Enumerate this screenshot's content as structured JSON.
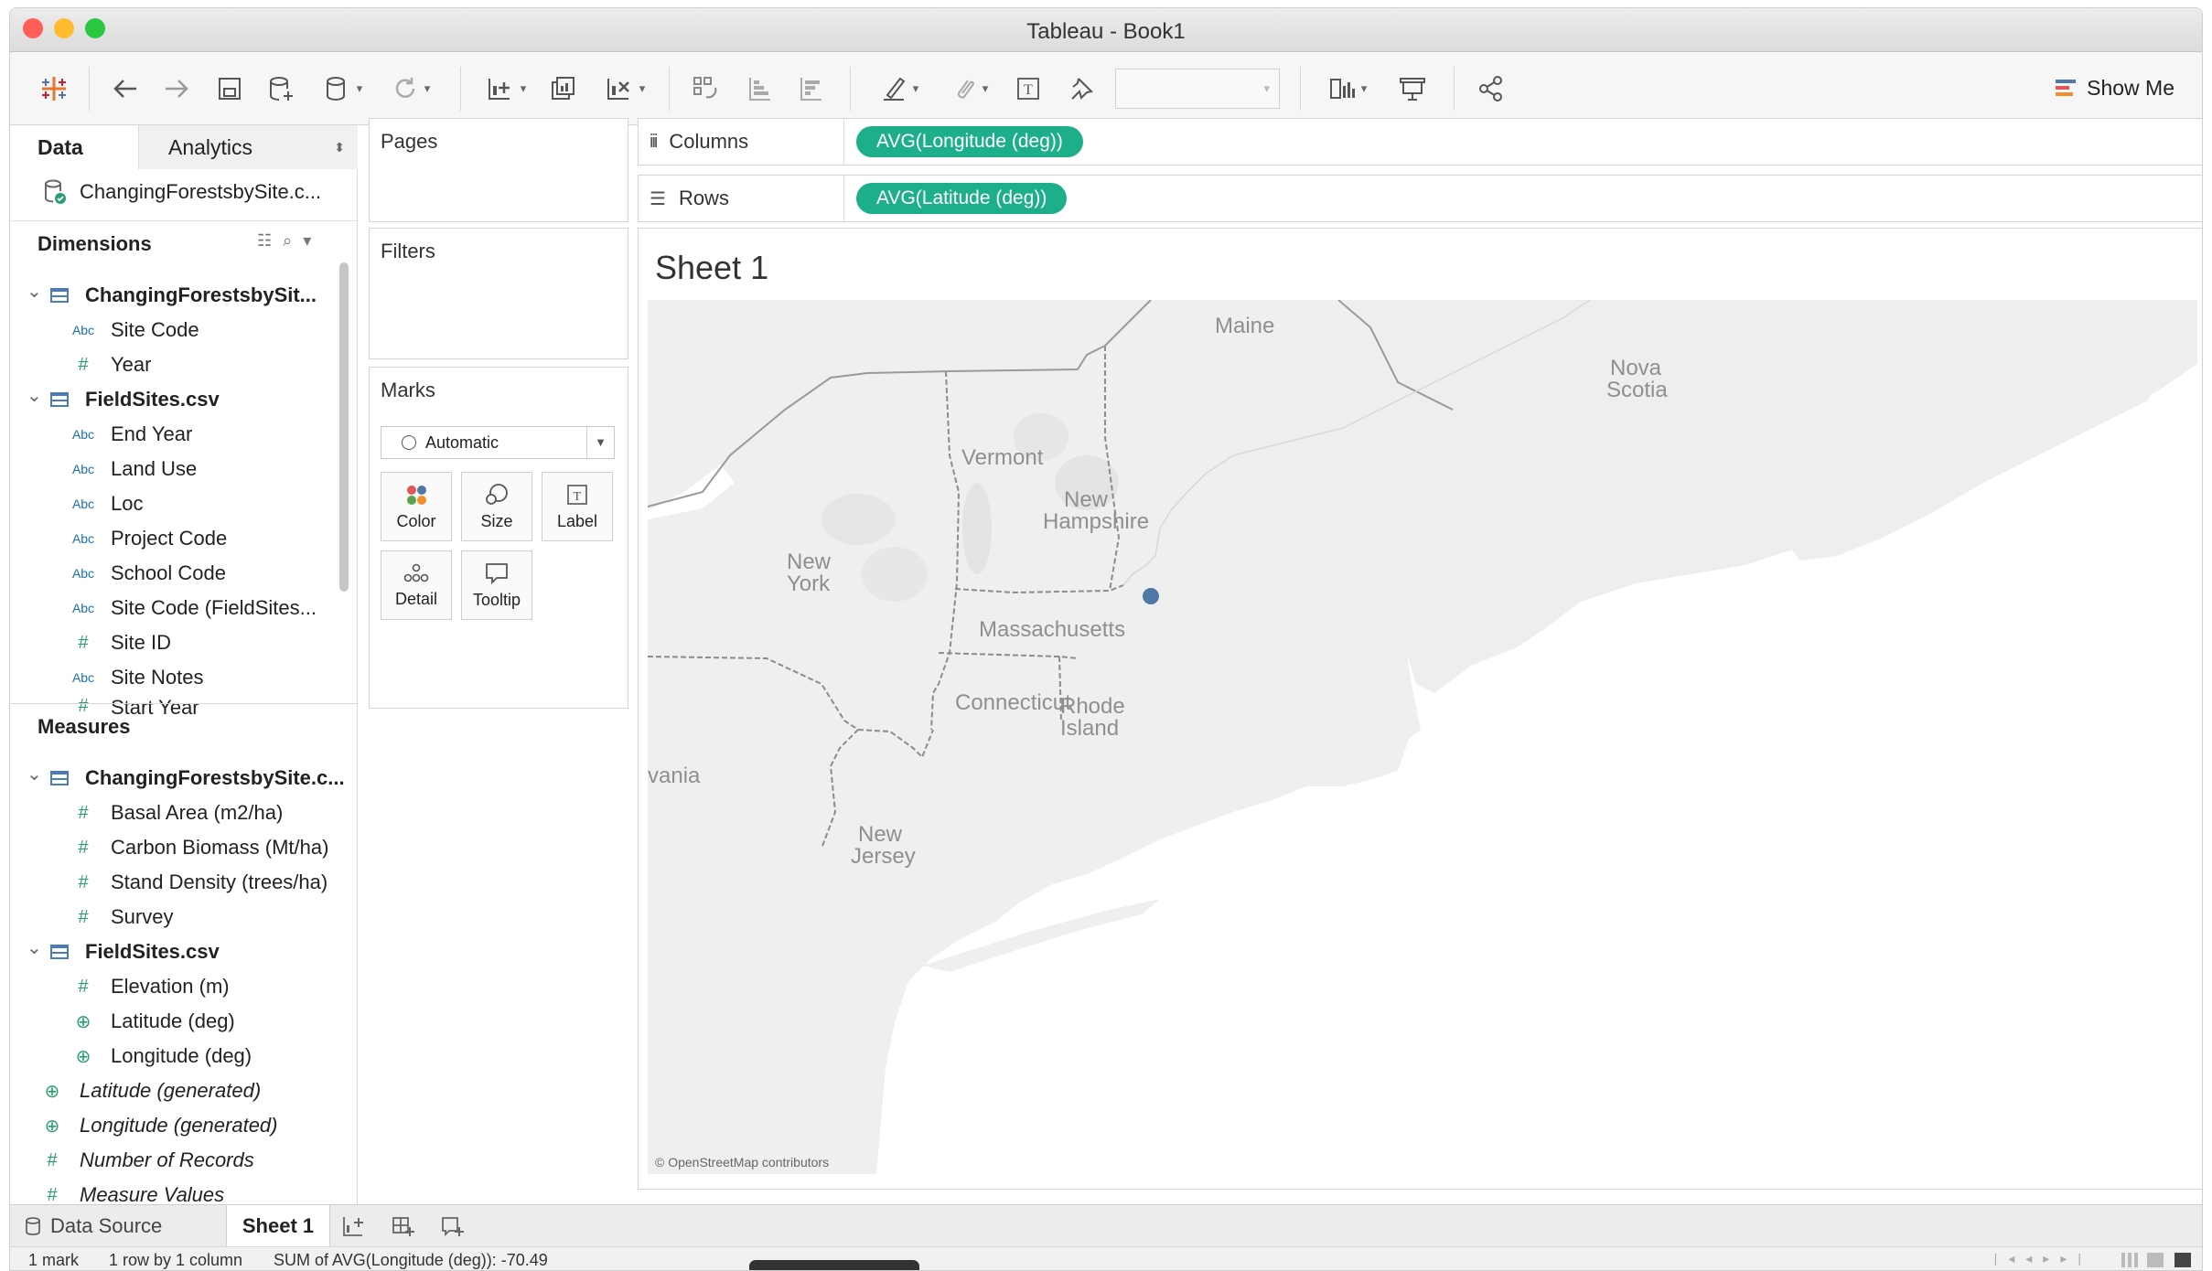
{
  "window": {
    "title": "Tableau - Book1"
  },
  "toolbar": {
    "show_me": "Show Me"
  },
  "left_pane": {
    "tabs": [
      "Data",
      "Analytics"
    ],
    "datasource": "ChangingForestsbySite.c...",
    "dimensions_label": "Dimensions",
    "measures_label": "Measures",
    "dimensions": [
      {
        "type": "table",
        "label": "ChangingForestsbySit..."
      },
      {
        "type": "abc",
        "label": "Site Code"
      },
      {
        "type": "num",
        "label": "Year"
      },
      {
        "type": "table",
        "label": "FieldSites.csv"
      },
      {
        "type": "abc",
        "label": "End Year"
      },
      {
        "type": "abc",
        "label": "Land Use"
      },
      {
        "type": "abc",
        "label": "Loc"
      },
      {
        "type": "abc",
        "label": "Project Code"
      },
      {
        "type": "abc",
        "label": "School Code"
      },
      {
        "type": "abc",
        "label": "Site Code (FieldSites..."
      },
      {
        "type": "num",
        "label": "Site ID"
      },
      {
        "type": "abc",
        "label": "Site Notes"
      },
      {
        "type": "num",
        "label": "Start Year"
      }
    ],
    "measures": [
      {
        "type": "table",
        "label": "ChangingForestsbySite.c..."
      },
      {
        "type": "num",
        "label": "Basal Area (m2/ha)"
      },
      {
        "type": "num",
        "label": "Carbon Biomass (Mt/ha)"
      },
      {
        "type": "num",
        "label": "Stand Density (trees/ha)"
      },
      {
        "type": "num",
        "label": "Survey"
      },
      {
        "type": "table",
        "label": "FieldSites.csv"
      },
      {
        "type": "num",
        "label": "Elevation (m)"
      },
      {
        "type": "geo",
        "label": "Latitude (deg)"
      },
      {
        "type": "geo",
        "label": "Longitude (deg)"
      },
      {
        "type": "geo",
        "label": "Latitude (generated)"
      },
      {
        "type": "geo",
        "label": "Longitude (generated)"
      },
      {
        "type": "num",
        "label": "Number of Records"
      },
      {
        "type": "num",
        "label": "Measure Values"
      }
    ]
  },
  "cards": {
    "pages": "Pages",
    "filters": "Filters",
    "marks": "Marks",
    "marks_type": "Automatic",
    "mark_buttons": [
      "Color",
      "Size",
      "Label",
      "Detail",
      "Tooltip"
    ]
  },
  "shelves": {
    "columns_label": "Columns",
    "columns_pill": "AVG(Longitude (deg))",
    "rows_label": "Rows",
    "rows_pill": "AVG(Latitude (deg))"
  },
  "view": {
    "sheet_title": "Sheet 1",
    "map_labels": {
      "maine": "Maine",
      "nova1": "Nova",
      "nova2": "Scotia",
      "vermont": "Vermont",
      "nh1": "New",
      "nh2": "Hampshire",
      "ny1": "New",
      "ny2": "York",
      "mass": "Massachusetts",
      "conn": "Connecticut",
      "ri1": "Rhode",
      "ri2": "Island",
      "penn": "vania",
      "nj1": "New",
      "nj2": "Jersey"
    },
    "attribution": "© OpenStreetMap contributors"
  },
  "sheet_tabs": {
    "data_source": "Data Source",
    "sheet1": "Sheet 1"
  },
  "status": {
    "marks": "1 mark",
    "dims": "1 row by 1 column",
    "sum": "SUM of AVG(Longitude (deg)): -70.49"
  }
}
